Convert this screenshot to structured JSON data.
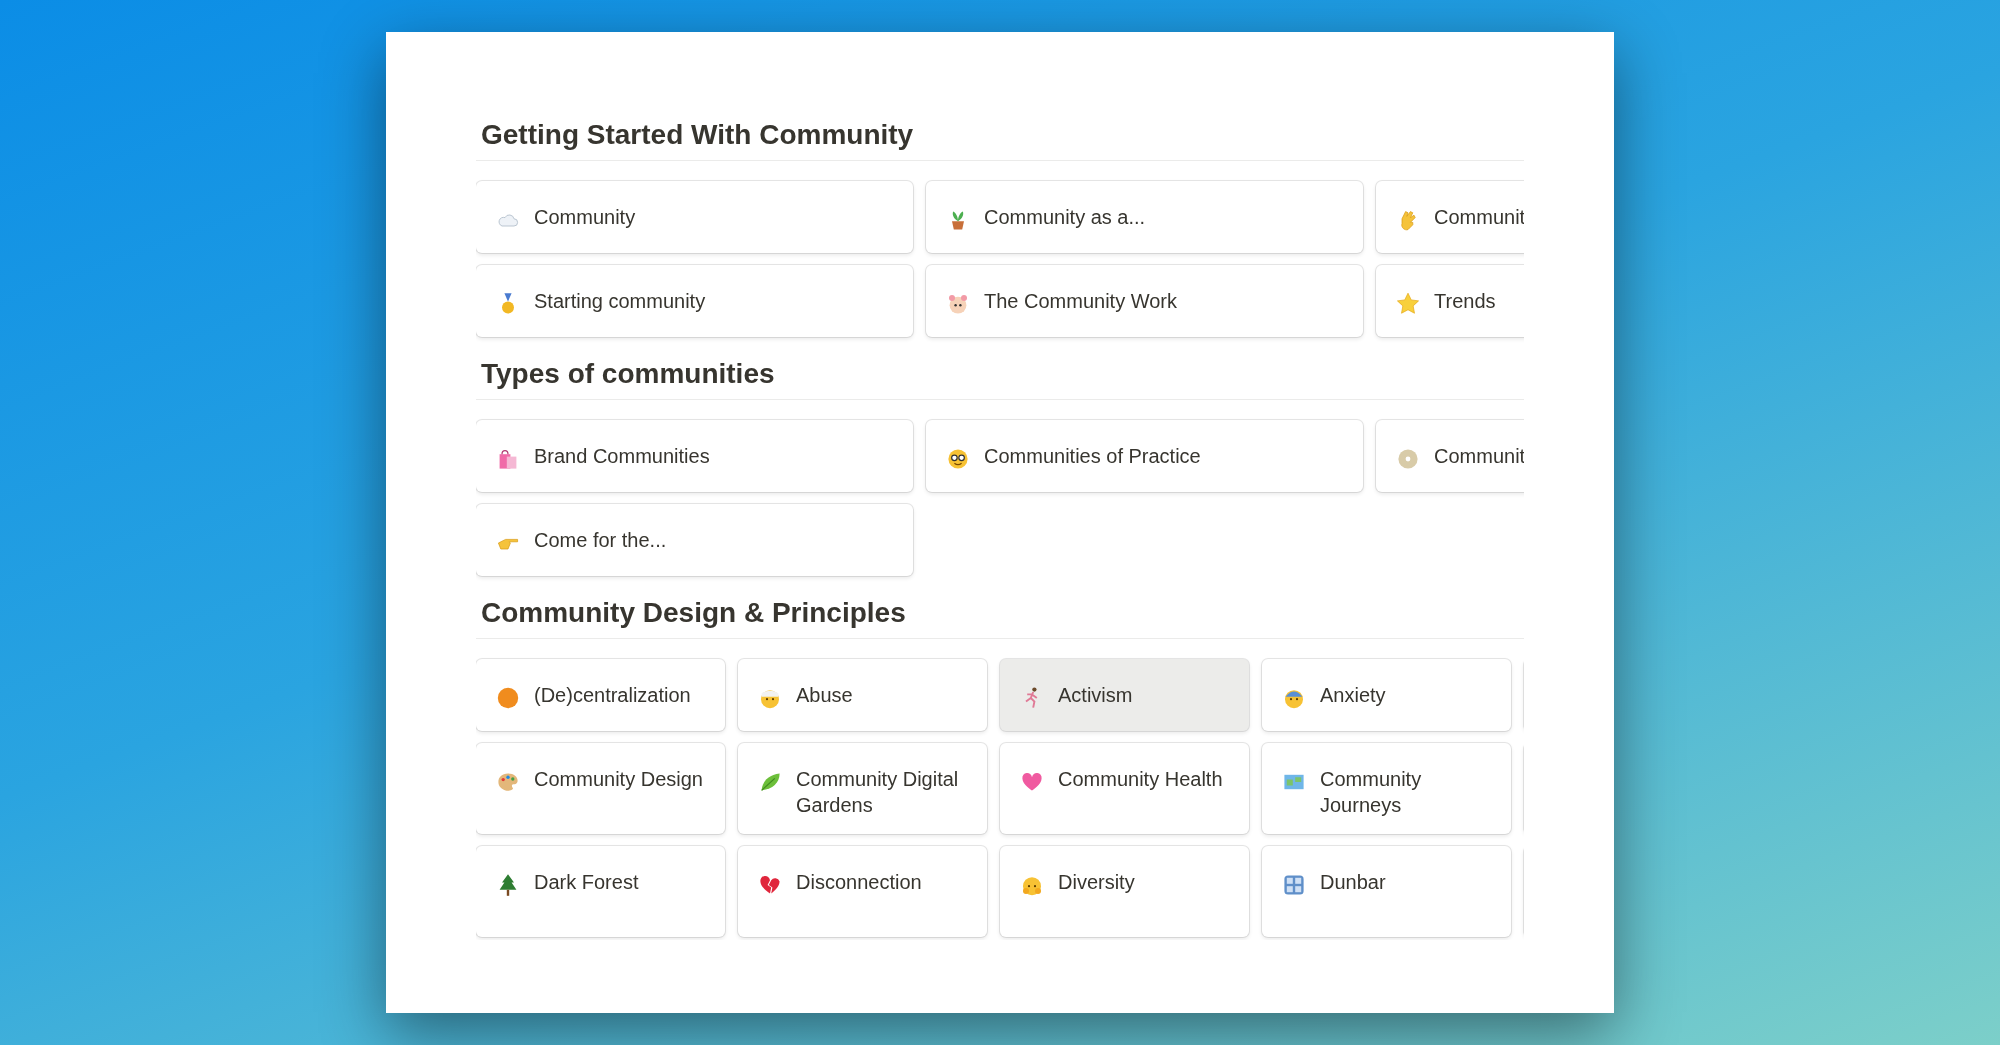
{
  "sections": [
    {
      "title": "Getting Started With Community",
      "kind": "wide",
      "cards": [
        {
          "label": "Community",
          "hovered": false
        },
        {
          "label": "Community as a...",
          "hovered": false
        },
        {
          "label": "Communit",
          "hovered": false
        },
        {
          "label": "Starting community",
          "hovered": false
        },
        {
          "label": "The Community Work",
          "hovered": false
        },
        {
          "label": "Trends",
          "hovered": false
        }
      ]
    },
    {
      "title": "Types of communities",
      "kind": "wide",
      "cards": [
        {
          "label": "Brand Communities",
          "hovered": false
        },
        {
          "label": "Communities of Practice",
          "hovered": false
        },
        {
          "label": "Communit",
          "hovered": false
        },
        {
          "label": "Come for the...",
          "hovered": false
        }
      ]
    },
    {
      "title": "Community Design & Principles",
      "kind": "narrow",
      "cards": [
        {
          "label": "(De)centralization",
          "hovered": false
        },
        {
          "label": "Abuse",
          "hovered": false
        },
        {
          "label": "Activism",
          "hovered": true
        },
        {
          "label": "Anxiety",
          "hovered": false
        },
        {
          "label": "Community Design",
          "hovered": false
        },
        {
          "label": "Community Digital Gardens",
          "hovered": false
        },
        {
          "label": "Community Health",
          "hovered": false
        },
        {
          "label": "Community Journeys",
          "hovered": false
        },
        {
          "label": "Dark Forest",
          "hovered": false
        },
        {
          "label": "Disconnection",
          "hovered": false
        },
        {
          "label": "Diversity",
          "hovered": false
        },
        {
          "label": "Dunbar",
          "hovered": false
        }
      ]
    }
  ]
}
